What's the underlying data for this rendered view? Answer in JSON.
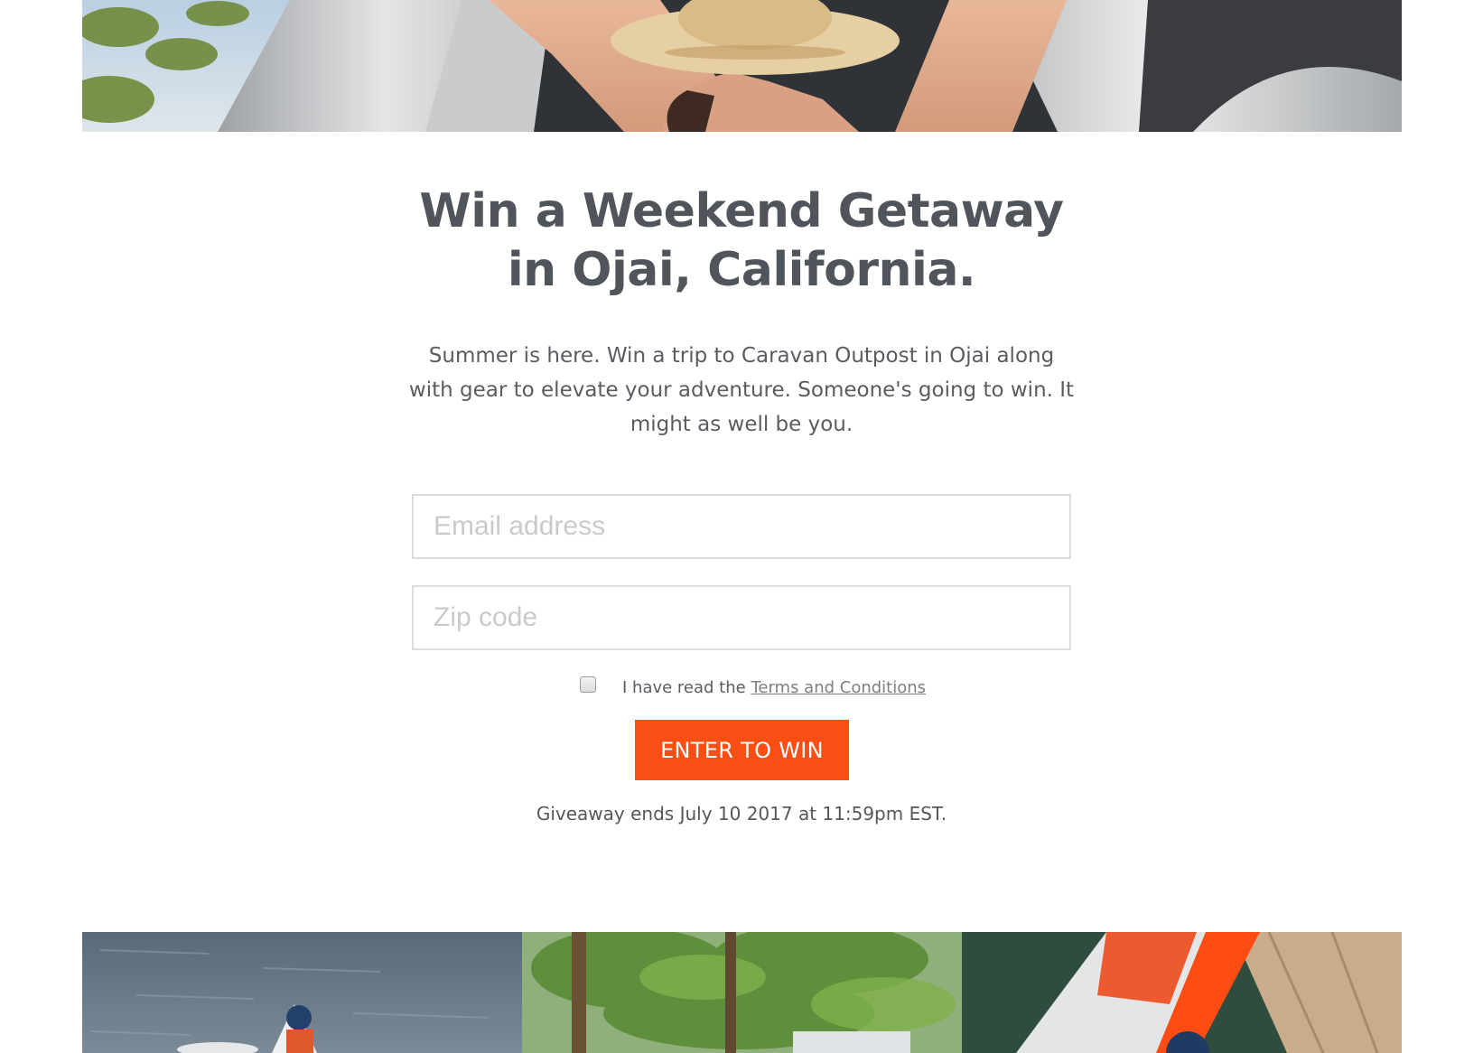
{
  "hero": {
    "image": "woman-in-straw-hat-airstream-photo"
  },
  "headline": {
    "line1": "Win a Weekend Getaway",
    "line2": "in Ojai, California."
  },
  "intro": {
    "text": "Summer is here. Win a trip to Caravan Outpost in Ojai along with gear to elevate your adventure. Someone's going to win. It might as well be you."
  },
  "form": {
    "email_placeholder": "Email address",
    "email_value": "",
    "zip_placeholder": "Zip code",
    "zip_value": "",
    "terms_checked": false,
    "terms_prefix": "I have read the ",
    "terms_link": "Terms and Conditions",
    "submit_label": "ENTER TO WIN"
  },
  "footer_note": "Giveaway ends July 10 2017 at 11:59pm EST.",
  "gallery": {
    "images": [
      "kayaker-on-lake-photo",
      "palm-trees-photo",
      "kayak-and-hammock-photo"
    ]
  },
  "colors": {
    "accent": "#fa4e14",
    "heading": "#50545b",
    "body_text": "#5a5c61",
    "input_border": "#dcdcde"
  }
}
